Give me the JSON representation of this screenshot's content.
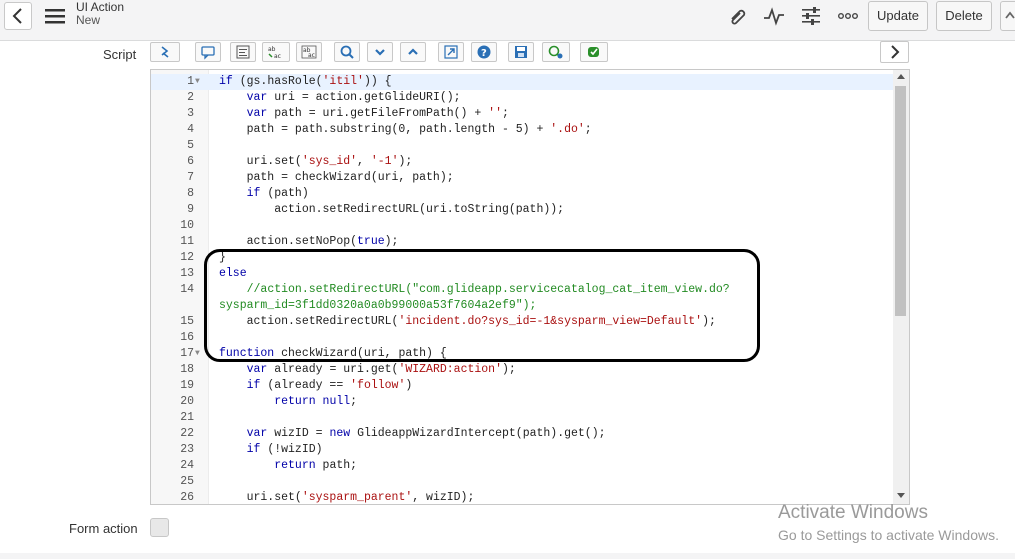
{
  "header": {
    "title": "UI Action",
    "subtitle": "New",
    "update_label": "Update",
    "delete_label": "Delete",
    "icons": [
      "back-icon",
      "hamburger-menu-icon",
      "attachment-icon",
      "activity-icon",
      "settings-sliders-icon",
      "more-icon"
    ]
  },
  "script": {
    "label": "Script",
    "toolbar_icons": [
      "toggle-syntax-icon",
      "comment-icon",
      "format-code-icon",
      "replace-icon",
      "replace-all-icon",
      "search-icon",
      "collapse-icon",
      "expand-icon",
      "fullscreen-icon",
      "help-icon",
      "save-icon",
      "script-debug-icon",
      "syntax-check-icon"
    ],
    "lines": [
      {
        "n": "1",
        "fold": true,
        "html": "<span class=\"kw\">if</span> (gs.hasRole(<span class=\"str\">'itil'</span>)) {"
      },
      {
        "n": "2",
        "html": "    <span class=\"kw\">var</span> uri = action.getGlideURI();"
      },
      {
        "n": "3",
        "html": "    <span class=\"kw\">var</span> path = uri.getFileFromPath() + <span class=\"str\">''</span>;"
      },
      {
        "n": "4",
        "html": "    path = path.substring(0, path.length - 5) + <span class=\"str\">'.do'</span>;"
      },
      {
        "n": "5",
        "html": ""
      },
      {
        "n": "6",
        "html": "    uri.set(<span class=\"str\">'sys_id'</span>, <span class=\"str\">'-1'</span>);"
      },
      {
        "n": "7",
        "html": "    path = checkWizard(uri, path);"
      },
      {
        "n": "8",
        "html": "    <span class=\"kw\">if</span> (path)"
      },
      {
        "n": "9",
        "html": "        action.setRedirectURL(uri.toString(path));"
      },
      {
        "n": "10",
        "html": ""
      },
      {
        "n": "11",
        "html": "    action.setNoPop(<span class=\"kw\">true</span>);"
      },
      {
        "n": "12",
        "html": "}"
      },
      {
        "n": "13",
        "html": "<span class=\"kw\">else</span>"
      },
      {
        "n": "14",
        "html": "    <span class=\"cmt\">//action.setRedirectURL(\"com.glideapp.servicecatalog_cat_item_view.do?</span>"
      },
      {
        "n": "",
        "html": "<span class=\"cmt\">sysparm_id=3f1dd0320a0a0b99000a53f7604a2ef9\");</span>"
      },
      {
        "n": "15",
        "html": "    action.setRedirectURL(<span class=\"str\">'incident.do?sys_id=-1&amp;sysparm_view=Default'</span>);"
      },
      {
        "n": "16",
        "html": ""
      },
      {
        "n": "17",
        "fold": true,
        "html": "<span class=\"kw\">function</span> checkWizard(uri, path) {"
      },
      {
        "n": "18",
        "html": "    <span class=\"kw\">var</span> already = uri.get(<span class=\"str\">'WIZARD:action'</span>);"
      },
      {
        "n": "19",
        "html": "    <span class=\"kw\">if</span> (already == <span class=\"str\">'follow'</span>)"
      },
      {
        "n": "20",
        "html": "        <span class=\"kw\">return</span> <span class=\"kw\">null</span>;"
      },
      {
        "n": "21",
        "html": ""
      },
      {
        "n": "22",
        "html": "    <span class=\"kw\">var</span> wizID = <span class=\"kw\">new</span> GlideappWizardIntercept(path).get();"
      },
      {
        "n": "23",
        "html": "    <span class=\"kw\">if</span> (!wizID)"
      },
      {
        "n": "24",
        "html": "        <span class=\"kw\">return</span> path;"
      },
      {
        "n": "25",
        "html": ""
      },
      {
        "n": "26",
        "html": "    uri.set(<span class=\"str\">'sysparm_parent'</span>, wizID);"
      }
    ]
  },
  "form_action": {
    "label": "Form action"
  },
  "watermark": {
    "title": "Activate Windows",
    "subtitle": "Go to Settings to activate Windows."
  }
}
